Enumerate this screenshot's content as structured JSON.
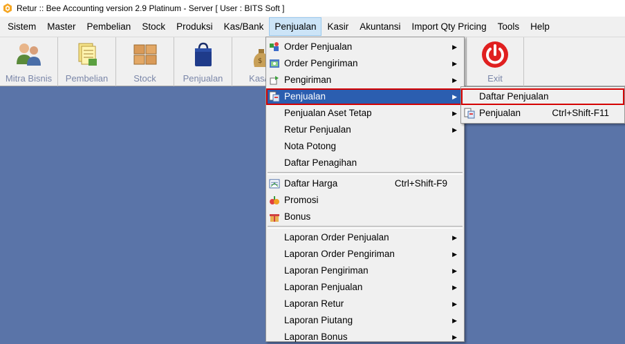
{
  "window": {
    "title": "Retur :: Bee Accounting version 2.9 Platinum - Server  [ User : BITS Soft ]",
    "icon": "bee-logo-icon"
  },
  "menubar": [
    {
      "label": "Sistem",
      "icon": ""
    },
    {
      "label": "Master",
      "icon": ""
    },
    {
      "label": "Pembelian",
      "icon": ""
    },
    {
      "label": "Stock",
      "icon": ""
    },
    {
      "label": "Produksi",
      "icon": ""
    },
    {
      "label": "Kas/Bank",
      "icon": ""
    },
    {
      "label": "Penjualan",
      "icon": "",
      "active": true
    },
    {
      "label": "Kasir",
      "icon": ""
    },
    {
      "label": "Akuntansi",
      "icon": ""
    },
    {
      "label": "Import Qty Pricing",
      "icon": ""
    },
    {
      "label": "Tools",
      "icon": ""
    },
    {
      "label": "Help",
      "icon": ""
    }
  ],
  "toolbar": [
    {
      "label": "Mitra Bisnis",
      "icon": "business-partners-icon"
    },
    {
      "label": "Pembelian",
      "icon": "purchase-documents-icon"
    },
    {
      "label": "Stock",
      "icon": "stock-boxes-icon"
    },
    {
      "label": "Penjualan",
      "icon": "shopping-bag-icon"
    },
    {
      "label": "Kas/B",
      "icon": "money-bag-icon"
    },
    {
      "label": "Exit",
      "icon": "power-icon"
    }
  ],
  "dropdown": {
    "group1": [
      {
        "label": "Order Penjualan",
        "icon": "sales-order-icon",
        "arrow": "▶"
      },
      {
        "label": "Order Pengiriman",
        "icon": "delivery-order-icon",
        "arrow": "▶"
      },
      {
        "label": "Pengiriman",
        "icon": "shipping-icon",
        "arrow": "▶"
      },
      {
        "label": "Penjualan",
        "icon": "sales-document-icon",
        "arrow": "▶",
        "highlight": true
      },
      {
        "label": "Penjualan Aset Tetap",
        "icon": "",
        "arrow": "▶"
      },
      {
        "label": "Retur Penjualan",
        "icon": "",
        "arrow": "▶"
      },
      {
        "label": "Nota Potong",
        "icon": "",
        "arrow": ""
      },
      {
        "label": "Daftar Penagihan",
        "icon": "",
        "arrow": ""
      }
    ],
    "group2": [
      {
        "label": "Daftar Harga",
        "icon": "price-list-icon",
        "shortcut": "Ctrl+Shift-F9"
      },
      {
        "label": "Promosi",
        "icon": "promotion-icon",
        "shortcut": ""
      },
      {
        "label": "Bonus",
        "icon": "bonus-gift-icon",
        "shortcut": ""
      }
    ],
    "group3": [
      {
        "label": "Laporan Order Penjualan",
        "arrow": "▶"
      },
      {
        "label": "Laporan Order Pengiriman",
        "arrow": "▶"
      },
      {
        "label": "Laporan Pengiriman",
        "arrow": "▶"
      },
      {
        "label": "Laporan Penjualan",
        "arrow": "▶"
      },
      {
        "label": "Laporan Retur",
        "arrow": "▶"
      },
      {
        "label": "Laporan Piutang",
        "arrow": "▶"
      },
      {
        "label": "Laporan Bonus",
        "arrow": "▶"
      }
    ]
  },
  "submenu": [
    {
      "label": "Daftar Penjualan",
      "icon": "",
      "shortcut": "",
      "boxed": true
    },
    {
      "label": "Penjualan",
      "icon": "sales-document-icon",
      "shortcut": "Ctrl+Shift-F11"
    }
  ],
  "colors": {
    "workspace": "#5a74a8",
    "highlight": "#2b5eb0",
    "callout_border": "#d40000"
  }
}
